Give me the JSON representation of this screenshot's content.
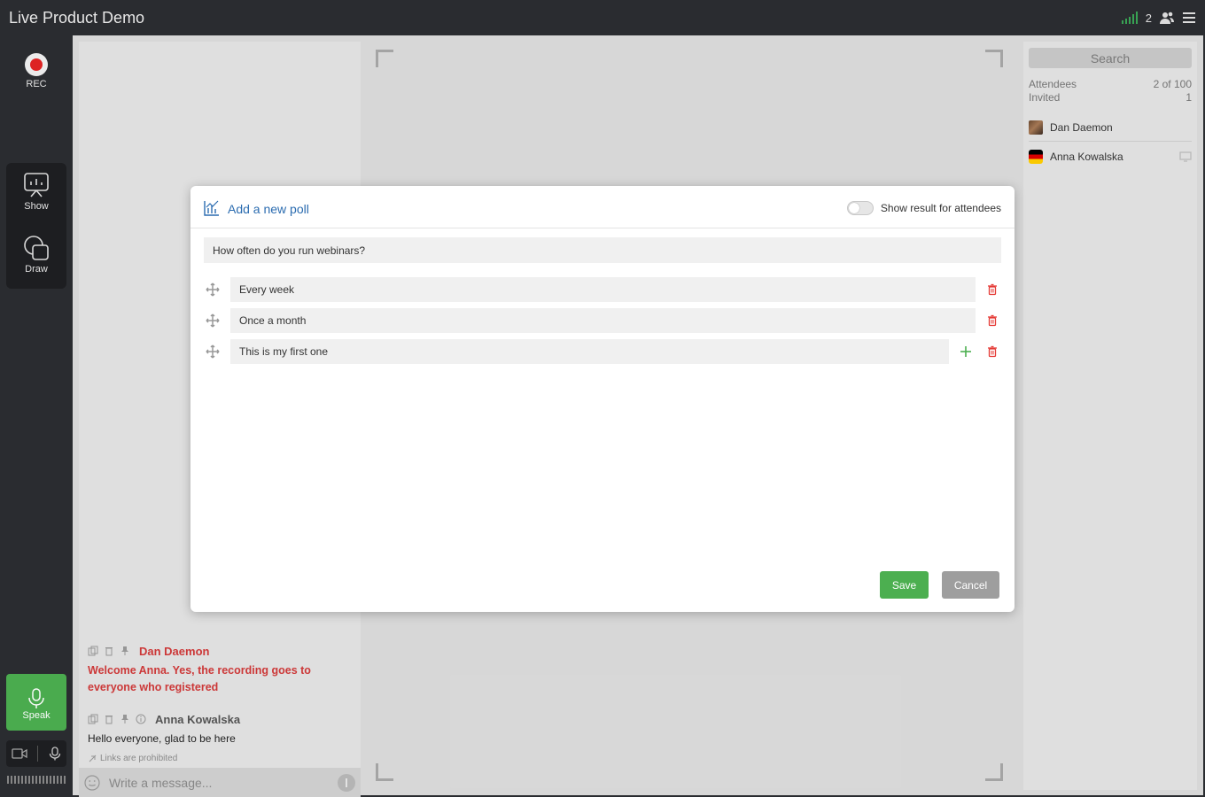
{
  "app": {
    "title": "Live Product Demo"
  },
  "topbar": {
    "participant_count": "2"
  },
  "rail": {
    "rec_label": "REC",
    "show_label": "Show",
    "draw_label": "Draw",
    "speak_label": "Speak"
  },
  "chat": {
    "messages": [
      {
        "author": "Dan Daemon",
        "text": "Welcome Anna. Yes, the recording goes to everyone who registered"
      },
      {
        "author": "Anna Kowalska",
        "text": "Hello everyone, glad to be here"
      }
    ],
    "links_note": "Links are prohibited",
    "input_placeholder": "Write a message..."
  },
  "people": {
    "search_placeholder": "Search",
    "attendees_label": "Attendees",
    "attendees_value": "2 of 100",
    "invited_label": "Invited",
    "invited_value": "1",
    "list": [
      {
        "name": "Dan Daemon"
      },
      {
        "name": "Anna Kowalska"
      }
    ]
  },
  "poll": {
    "title": "Add a new poll",
    "toggle_label": "Show result for attendees",
    "question": "How often do you run webinars?",
    "options": [
      {
        "value": "Every week"
      },
      {
        "value": "Once a month"
      },
      {
        "value": "This is my first one"
      }
    ],
    "save_label": "Save",
    "cancel_label": "Cancel"
  },
  "colors": {
    "accent_blue": "#2b6cb0",
    "save_green": "#4caf50",
    "delete_red": "#e53935",
    "host_red": "#d13a3a"
  }
}
